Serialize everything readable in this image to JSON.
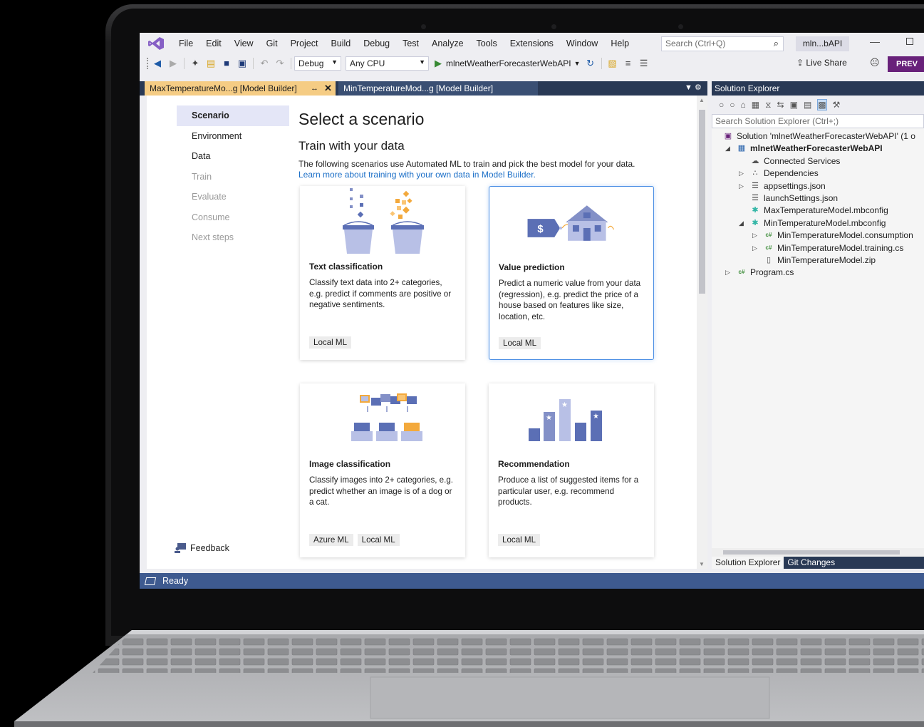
{
  "menubar": {
    "items": [
      "File",
      "Edit",
      "View",
      "Git",
      "Project",
      "Build",
      "Debug",
      "Test",
      "Analyze",
      "Tools",
      "Extensions",
      "Window",
      "Help"
    ],
    "search_placeholder": "Search (Ctrl+Q)",
    "project_badge": "mln...bAPI"
  },
  "toolbar": {
    "config": "Debug",
    "platform": "Any CPU",
    "run_target": "mlnetWeatherForecasterWebAPI",
    "live_share": "Live Share",
    "preview": "PREV"
  },
  "tabs": {
    "active": "MaxTemperatureMo...g [Model Builder]",
    "inactive": "MinTemperatureMod...g [Model Builder]"
  },
  "steps": [
    {
      "label": "Scenario",
      "state": "active"
    },
    {
      "label": "Environment",
      "state": "enabled"
    },
    {
      "label": "Data",
      "state": "enabled"
    },
    {
      "label": "Train",
      "state": "disabled"
    },
    {
      "label": "Evaluate",
      "state": "disabled"
    },
    {
      "label": "Consume",
      "state": "disabled"
    },
    {
      "label": "Next steps",
      "state": "disabled"
    }
  ],
  "feedback_label": "Feedback",
  "main": {
    "title": "Select a scenario",
    "section": "Train with your data",
    "description": "The following scenarios use Automated ML to train and pick the best model for your data.",
    "learn_link": "Learn more about training with your own data in Model Builder."
  },
  "cards": [
    {
      "title": "Text classification",
      "desc": "Classify text data into 2+ categories, e.g. predict if comments are positive or negative sentiments.",
      "tags": [
        "Local ML"
      ]
    },
    {
      "title": "Value prediction",
      "desc": "Predict a numeric value from your data (regression), e.g. predict the price of a house based on features like size, location, etc.",
      "tags": [
        "Local ML"
      ]
    },
    {
      "title": "Image classification",
      "desc": "Classify images into 2+ categories, e.g. predict whether an image is of a dog or a cat.",
      "tags": [
        "Azure ML",
        "Local ML"
      ]
    },
    {
      "title": "Recommendation",
      "desc": "Produce a list of suggested items for a particular user, e.g. recommend products.",
      "tags": [
        "Local ML"
      ]
    }
  ],
  "status": "Ready",
  "solution_explorer": {
    "title": "Solution Explorer",
    "search_placeholder": "Search Solution Explorer (Ctrl+;)",
    "nodes": [
      {
        "label": "Solution 'mlnetWeatherForecasterWebAPI' (1 o",
        "icon": "solution-icon",
        "depth": 0,
        "expander": ""
      },
      {
        "label": "mlnetWeatherForecasterWebAPI",
        "icon": "web-project-icon",
        "depth": 1,
        "expander": "expanded",
        "bold": true
      },
      {
        "label": "Connected Services",
        "icon": "connected-services-icon",
        "depth": 2,
        "expander": ""
      },
      {
        "label": "Dependencies",
        "icon": "dependencies-icon",
        "depth": 2,
        "expander": "collapsed"
      },
      {
        "label": "appsettings.json",
        "icon": "json-file-icon",
        "depth": 2,
        "expander": "collapsed"
      },
      {
        "label": "launchSettings.json",
        "icon": "json-file-icon",
        "depth": 2,
        "expander": ""
      },
      {
        "label": "MaxTemperatureModel.mbconfig",
        "icon": "mbconfig-icon",
        "depth": 2,
        "expander": ""
      },
      {
        "label": "MinTemperatureModel.mbconfig",
        "icon": "mbconfig-icon",
        "depth": 2,
        "expander": "expanded"
      },
      {
        "label": "MinTemperatureModel.consumption",
        "icon": "csharp-file-icon",
        "depth": 3,
        "expander": "collapsed"
      },
      {
        "label": "MinTemperatureModel.training.cs",
        "icon": "csharp-file-icon",
        "depth": 3,
        "expander": "collapsed"
      },
      {
        "label": "MinTemperatureModel.zip",
        "icon": "file-icon",
        "depth": 3,
        "expander": ""
      },
      {
        "label": "Program.cs",
        "icon": "csharp-file-icon",
        "depth": 1,
        "expander": "collapsed"
      }
    ],
    "bottom_tabs": [
      "Solution Explorer",
      "Git Changes"
    ]
  },
  "colors": {
    "accent": "#68217a",
    "tab_active": "#f5cc84",
    "tab_strip": "#293955",
    "status_bar": "#3e5a8f",
    "link": "#1a6ec7",
    "illustration_blue": "#5b6fb5",
    "illustration_orange": "#f3a93c"
  }
}
